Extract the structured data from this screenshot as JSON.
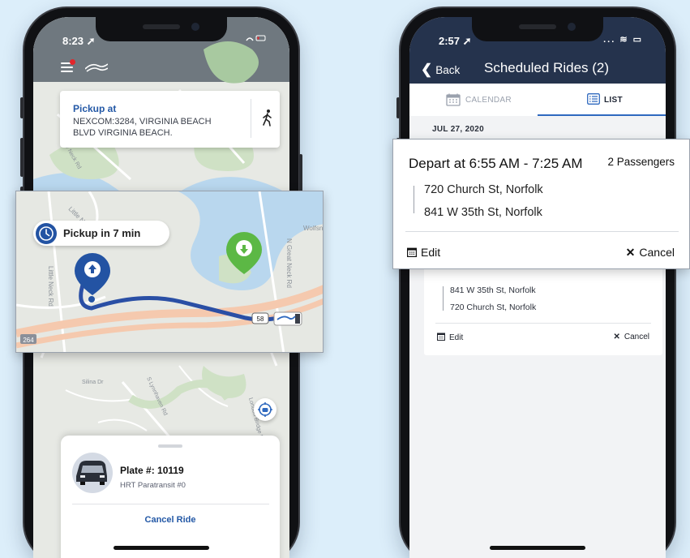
{
  "colors": {
    "navy": "#25334d",
    "accent_blue": "#2f69bf",
    "pin_blue": "#2353a3",
    "pin_green": "#5cb845",
    "route": "#2a4fa5",
    "background": "#dceefa"
  },
  "left_phone": {
    "status": {
      "time": "8:23 ➚"
    },
    "pickup_card": {
      "label": "Pickup at",
      "address": "NEXCOM:3284, VIRGINIA BEACH BLVD VIRGINIA BEACH.",
      "mode_icon": "walking-person-icon"
    },
    "map_labels": {
      "left": "Little Neck Rd",
      "right": "N Great Neck Rd",
      "mid": "Wolfsnare",
      "bottom": "Silina Dr",
      "bottom2": "S Lynnhaven Rd",
      "bottom3": "London Bridge Rd",
      "shield_58": "58",
      "shield_264": "264"
    },
    "sheet": {
      "plate": "Plate #: 10119",
      "vehicle": "HRT Paratransit #0",
      "cancel": "Cancel Ride"
    }
  },
  "map_zoom": {
    "eta_label": "Pickup in 7 min",
    "road_left": "Little Neck Rd",
    "road_right": "N Great Neck Rd",
    "road_top": "Little Neck Rd",
    "road_wolf": "Wolfsnare",
    "shield_58": "58",
    "shield_264": "264"
  },
  "right_phone": {
    "status": {
      "time": "2:57 ➚",
      "icons": "... ≋ ▭"
    },
    "nav": {
      "back": "Back",
      "title": "Scheduled Rides (2)"
    },
    "tabs": [
      {
        "label": "CALENDAR",
        "active": false
      },
      {
        "label": "LIST",
        "active": true
      }
    ],
    "date_header": "JUL 27, 2020",
    "ride2": {
      "from": "841 W 35th St, Norfolk",
      "to": "720 Church St, Norfolk",
      "edit": "Edit",
      "cancel": "Cancel"
    }
  },
  "ride_zoom": {
    "depart": "Depart at 6:55 AM - 7:25 AM",
    "passengers": "2 Passengers",
    "from": "720 Church St, Norfolk",
    "to": "841 W 35th St, Norfolk",
    "edit": "Edit",
    "cancel": "Cancel"
  }
}
